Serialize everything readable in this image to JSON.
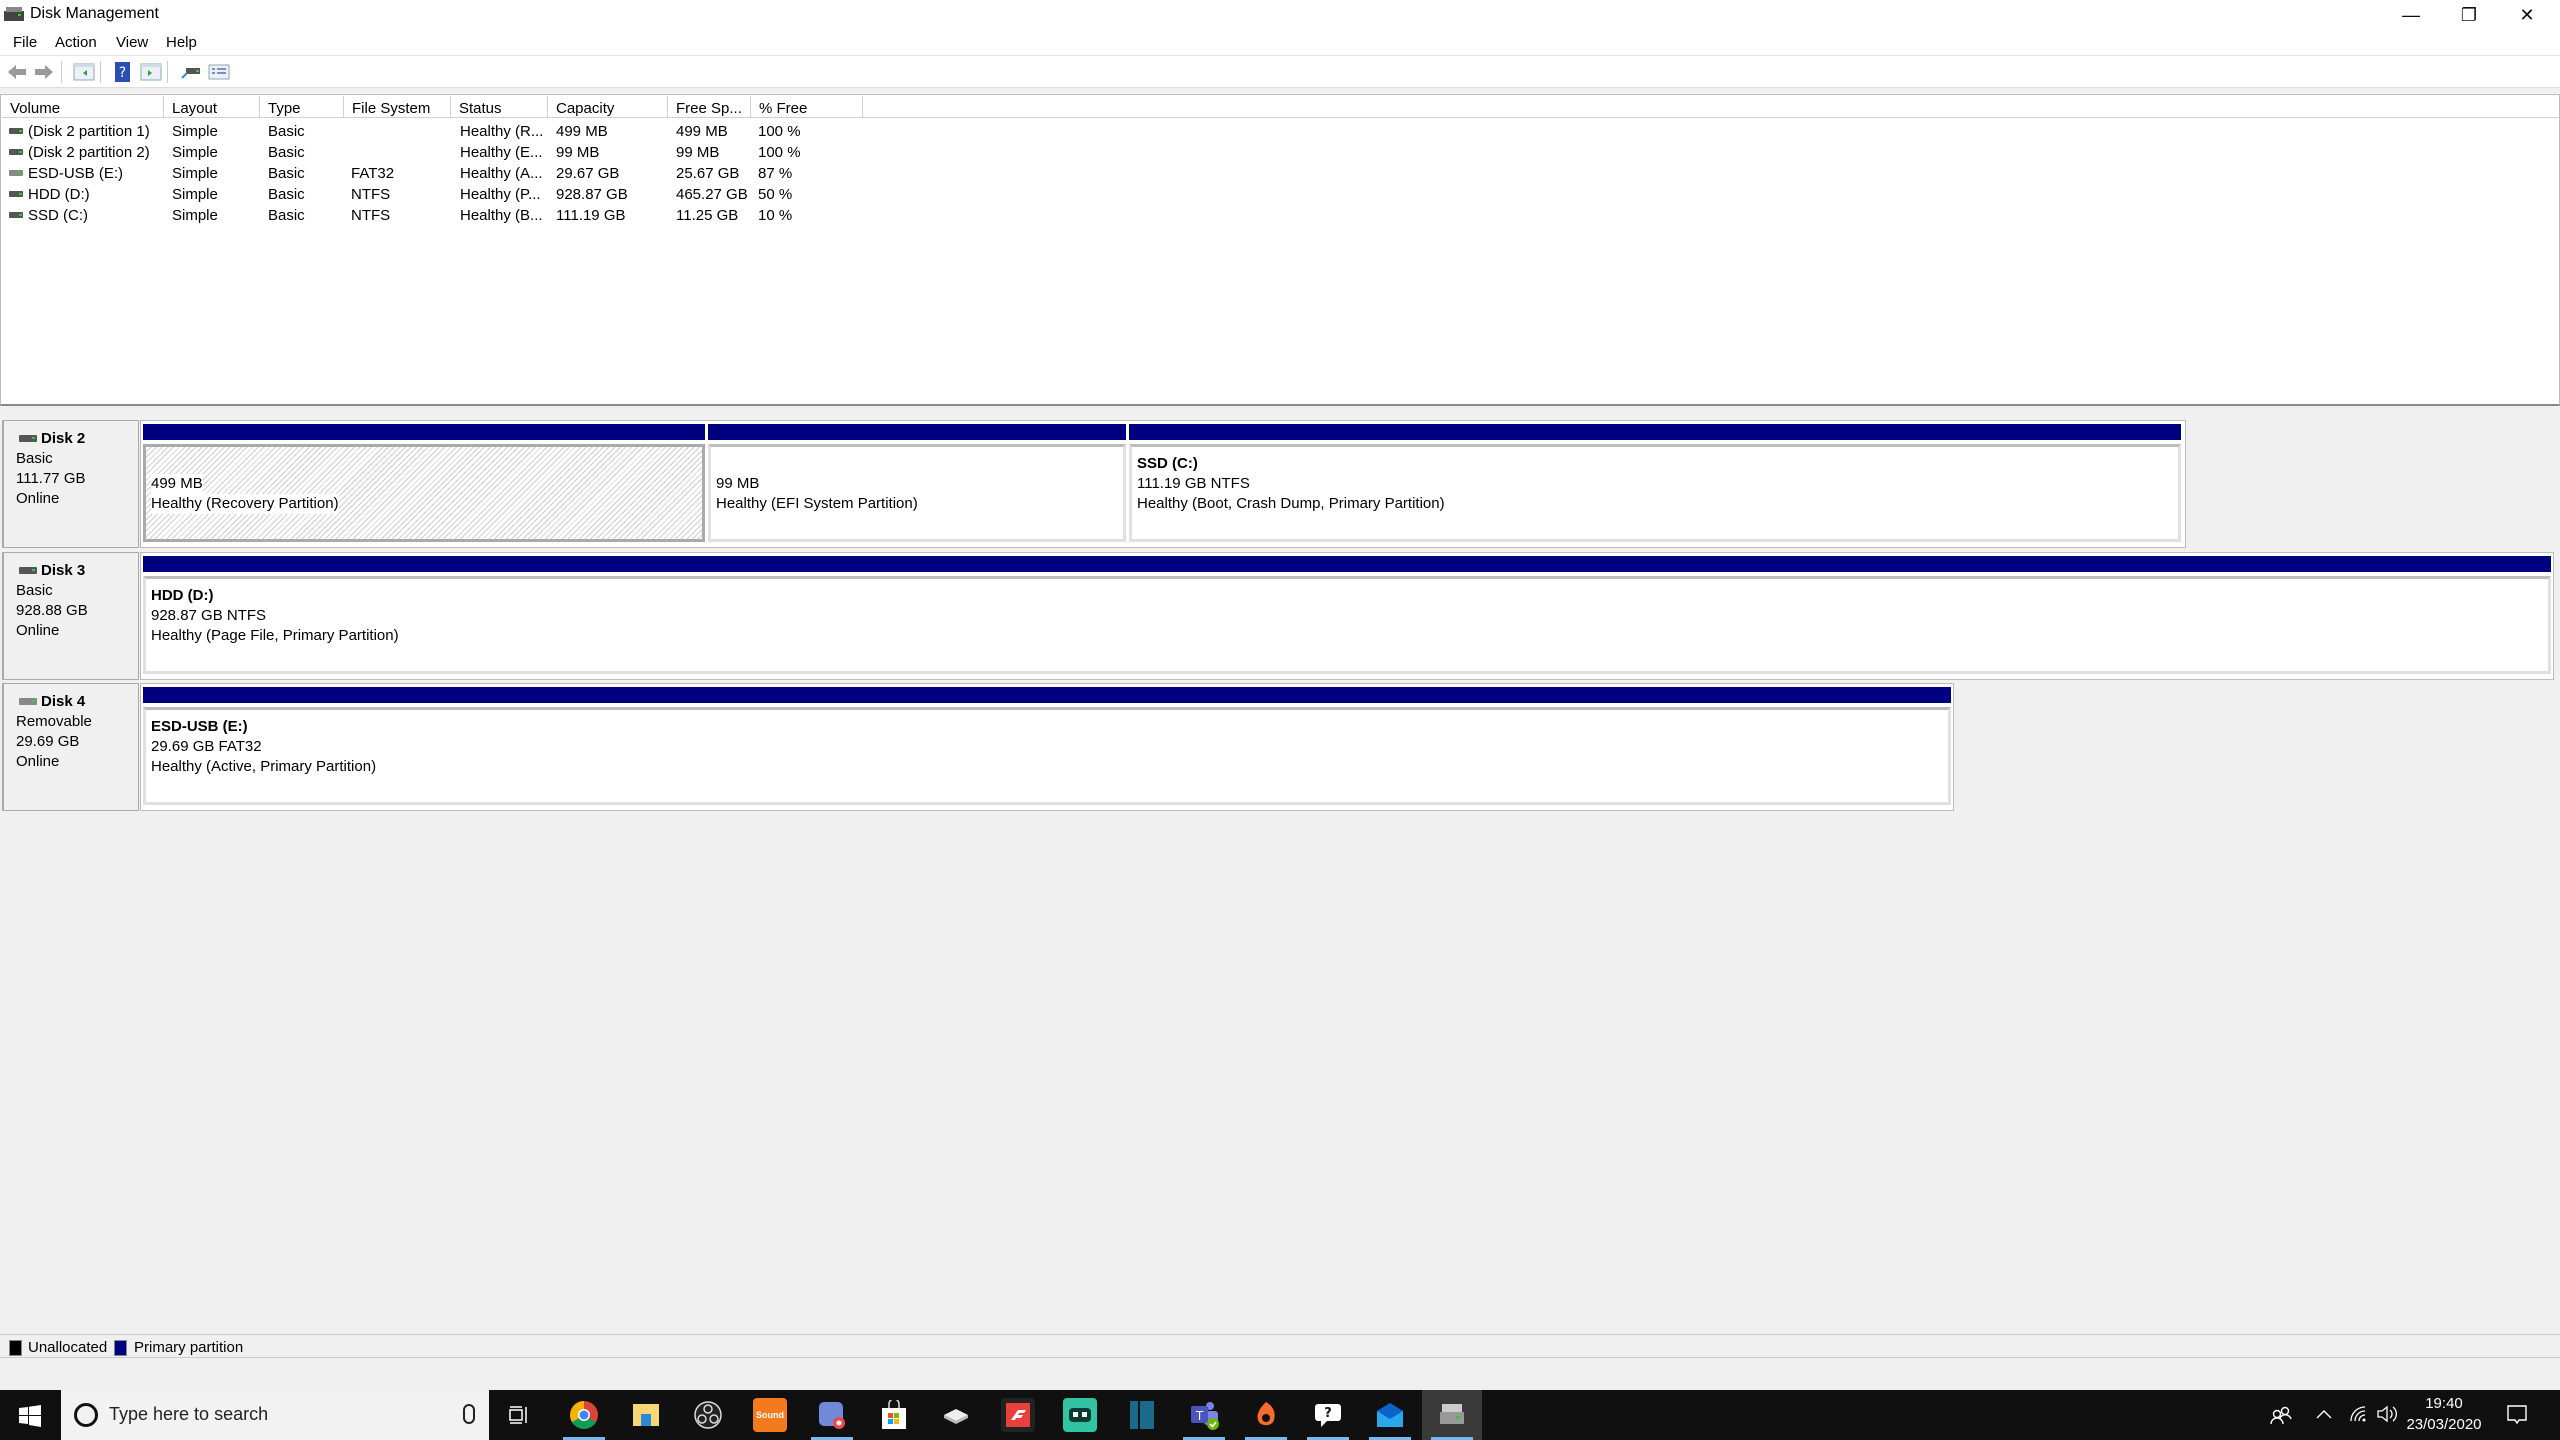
{
  "window": {
    "title": "Disk Management",
    "controls": {
      "minimize": "—",
      "restore": "❐",
      "close": "✕"
    }
  },
  "menu": [
    "File",
    "Action",
    "View",
    "Help"
  ],
  "toolbar": [
    "back-icon",
    "forward-icon",
    "show-hide-console-tree-icon",
    "help-icon",
    "show-hide-action-pane-icon",
    "connect-disk-icon",
    "properties-icon"
  ],
  "volume_list": {
    "columns": [
      "Volume",
      "Layout",
      "Type",
      "File System",
      "Status",
      "Capacity",
      "Free Sp...",
      "% Free"
    ],
    "rows": [
      {
        "volume": "(Disk 2 partition 1)",
        "layout": "Simple",
        "type": "Basic",
        "fs": "",
        "status": "Healthy (R...",
        "capacity": "499 MB",
        "free": "499 MB",
        "pct": "100 %"
      },
      {
        "volume": "(Disk 2 partition 2)",
        "layout": "Simple",
        "type": "Basic",
        "fs": "",
        "status": "Healthy (E...",
        "capacity": "99 MB",
        "free": "99 MB",
        "pct": "100 %"
      },
      {
        "volume": "ESD-USB (E:)",
        "layout": "Simple",
        "type": "Basic",
        "fs": "FAT32",
        "status": "Healthy (A...",
        "capacity": "29.67 GB",
        "free": "25.67 GB",
        "pct": "87 %"
      },
      {
        "volume": "HDD (D:)",
        "layout": "Simple",
        "type": "Basic",
        "fs": "NTFS",
        "status": "Healthy (P...",
        "capacity": "928.87 GB",
        "free": "465.27 GB",
        "pct": "50 %"
      },
      {
        "volume": "SSD (C:)",
        "layout": "Simple",
        "type": "Basic",
        "fs": "NTFS",
        "status": "Healthy (B...",
        "capacity": "111.19 GB",
        "free": "11.25 GB",
        "pct": "10 %"
      }
    ]
  },
  "disks": [
    {
      "name": "Disk 2",
      "kind": "Basic",
      "size": "111.77 GB",
      "state": "Online",
      "partitions": [
        {
          "label": "",
          "size": "499 MB",
          "status": "Healthy (Recovery Partition)"
        },
        {
          "label": "",
          "size": "99 MB",
          "status": "Healthy (EFI System Partition)"
        },
        {
          "label": "SSD  (C:)",
          "size": "111.19 GB NTFS",
          "status": "Healthy (Boot, Crash Dump, Primary Partition)"
        }
      ]
    },
    {
      "name": "Disk 3",
      "kind": "Basic",
      "size": "928.88 GB",
      "state": "Online",
      "partitions": [
        {
          "label": "HDD  (D:)",
          "size": "928.87 GB NTFS",
          "status": "Healthy (Page File, Primary Partition)"
        }
      ]
    },
    {
      "name": "Disk 4",
      "kind": "Removable",
      "size": "29.69 GB",
      "state": "Online",
      "partitions": [
        {
          "label": "ESD-USB  (E:)",
          "size": "29.69 GB FAT32",
          "status": "Healthy (Active, Primary Partition)"
        }
      ]
    }
  ],
  "legend": [
    {
      "label": "Unallocated",
      "color": "#000000"
    },
    {
      "label": "Primary partition",
      "color": "#000080"
    }
  ],
  "taskbar": {
    "search_placeholder": "Type here to search",
    "apps": [
      "task-view",
      "chrome",
      "file-explorer",
      "obs-studio",
      "sound-blaster",
      "discord",
      "microsoft-store",
      "disk-drive",
      "forza",
      "streamlabs",
      "app-panel",
      "teams",
      "origin",
      "feedback-hub",
      "mail",
      "disk-management"
    ],
    "time": "19:40",
    "date": "23/03/2020"
  }
}
